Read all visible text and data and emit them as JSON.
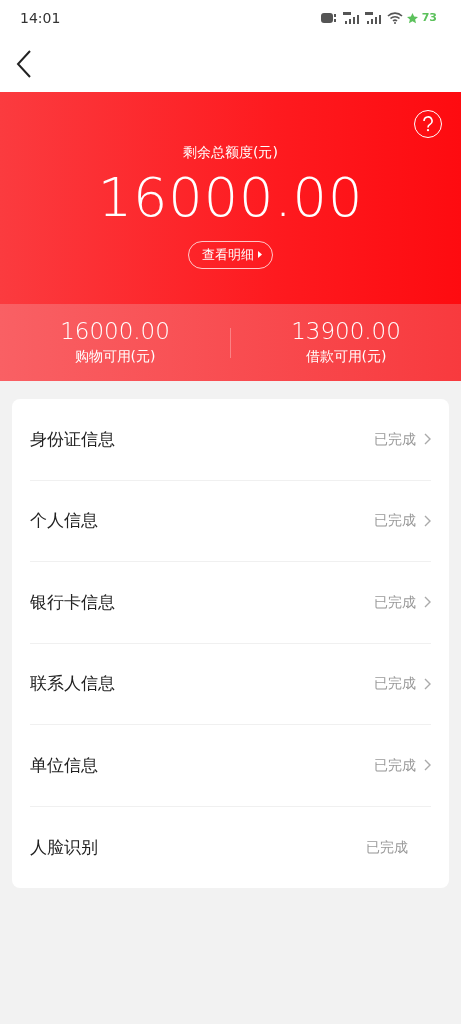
{
  "status_bar": {
    "time": "14:01",
    "battery": "73"
  },
  "summary": {
    "title": "剩余总额度(元)",
    "amount": "16000.00",
    "detail_button": "查看明细",
    "sub": [
      {
        "amount": "16000.00",
        "label": "购物可用(元)"
      },
      {
        "amount": "13900.00",
        "label": "借款可用(元)"
      }
    ]
  },
  "items": [
    {
      "label": "身份证信息",
      "status": "已完成",
      "has_arrow": true
    },
    {
      "label": "个人信息",
      "status": "已完成",
      "has_arrow": true
    },
    {
      "label": "银行卡信息",
      "status": "已完成",
      "has_arrow": true
    },
    {
      "label": "联系人信息",
      "status": "已完成",
      "has_arrow": true
    },
    {
      "label": "单位信息",
      "status": "已完成",
      "has_arrow": true
    },
    {
      "label": "人脸识别",
      "status": "已完成",
      "has_arrow": false
    }
  ]
}
